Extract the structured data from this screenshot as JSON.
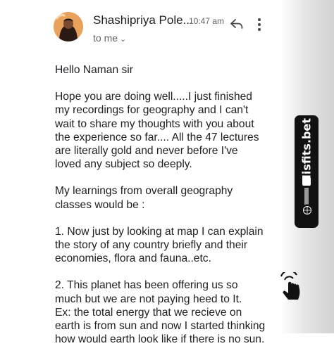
{
  "header": {
    "sender_name": "Shashipriya Pole...",
    "time": "10:47 am",
    "to_label": "to me"
  },
  "icons": {
    "reply": "reply-icon",
    "more": "more-vert-icon",
    "expand": "chevron-down-icon"
  },
  "message": {
    "greeting": "Hello Naman sir",
    "paragraphs": [
      "    Hope you are doing well.....I just finished my recordings for geography and I can't wait to share my thoughts with you about the experience so far.... All the 47 lectures are literally gold and never before I've loved any subject so deeply.",
      "    My learnings from overall geography classes would be :",
      "1. Now just by looking at map I can explain the story of any country briefly and their economies, flora and fauna..etc.",
      "2. This planet has been offering us so much but we are not paying heed to It.\nEx: the total energy that we recieve on earth is from sun and now I started thinking how would earth look like if there is no sun."
    ]
  },
  "watermark": {
    "text": "Misfits.bet"
  },
  "colors": {
    "watermark_bg": "#111111",
    "secondary_text": "#5f6368"
  }
}
